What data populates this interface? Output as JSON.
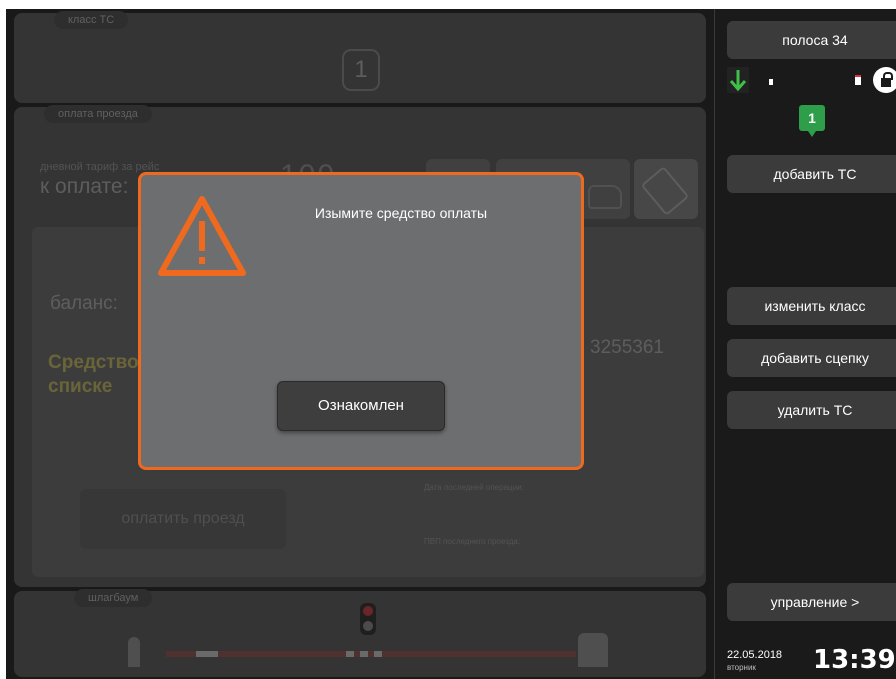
{
  "class_panel": {
    "label": "класс ТС",
    "value": "1"
  },
  "payment_panel": {
    "label": "оплата проезда",
    "tariff_note": "дневной тариф за рейс",
    "to_pay_label": "к оплате:",
    "amount": "100",
    "balance_label": "баланс:",
    "card_status": "Средство в списке",
    "card_number": "3255361",
    "last_operation_label": "Дата последней операции:",
    "last_pass_label": "ПВП последнего проезда:",
    "pay_button": "оплатить проезд"
  },
  "barrier_panel": {
    "label": "шлагбаум"
  },
  "modal": {
    "message": "Изымите средство оплаты",
    "ack_button": "Ознакомлен"
  },
  "sidebar": {
    "lane_button": "полоса 34",
    "vehicle_count_badge": "1",
    "add_vehicle_button": "добавить ТС",
    "change_class_button": "изменить класс",
    "add_hitch_button": "добавить сцепку",
    "delete_vehicle_button": "удалить ТС",
    "management_button": "управление >",
    "date": "22.05.2018",
    "weekday": "вторник",
    "time": "13:39"
  },
  "colors": {
    "accent": "#ef6a1e",
    "lane_open": "#2e9e4a",
    "background": "#1a1a1a"
  }
}
